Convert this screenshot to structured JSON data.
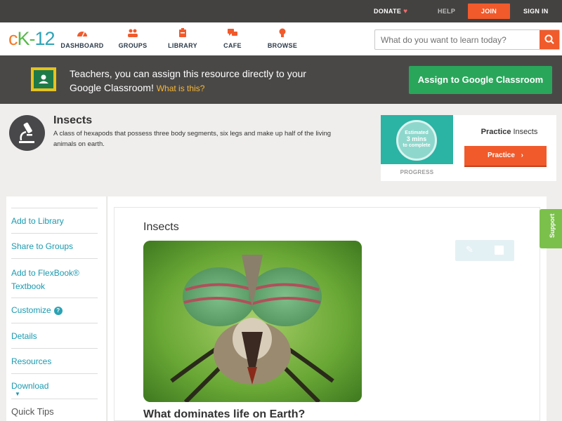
{
  "topbar": {
    "donate_label": "DONATE",
    "help_label": "HELP",
    "join_label": "JOIN",
    "signin_label": "SIGN IN"
  },
  "header": {
    "logo_c": "c",
    "logo_k": "K",
    "logo_dash": "-",
    "logo_num": "12",
    "nav": [
      {
        "label": "DASHBOARD",
        "icon": "dashboard-icon"
      },
      {
        "label": "GROUPS",
        "icon": "groups-icon"
      },
      {
        "label": "LIBRARY",
        "icon": "library-icon"
      },
      {
        "label": "CAFE",
        "icon": "cafe-icon"
      },
      {
        "label": "BROWSE",
        "icon": "browse-icon"
      }
    ],
    "search_placeholder": "What do you want to learn today?"
  },
  "banner": {
    "text": "Teachers, you can assign this resource directly to your Google Classroom!",
    "link": "What is this?",
    "button": "Assign to Google Classroom"
  },
  "concept": {
    "title": "Insects",
    "description": "A class of hexapods that possess three body segments, six legs and make up half of the living animals on earth.",
    "practice": {
      "circle_line1": "Estimated",
      "circle_mins": "3 mins",
      "circle_line3": "to complete",
      "progress_label": "PROGRESS",
      "title_bold": "Practice",
      "title_rest": "Insects",
      "button": "Practice"
    }
  },
  "sidebar": {
    "items": [
      {
        "label": "Add to Library"
      },
      {
        "label": "Share to Groups"
      },
      {
        "label": "Add to FlexBook® Textbook"
      },
      {
        "label": "Customize"
      },
      {
        "label": "Details"
      },
      {
        "label": "Resources"
      },
      {
        "label": "Download"
      },
      {
        "label": "Quick Tips"
      }
    ],
    "badge": "?"
  },
  "main": {
    "title": "Insects",
    "subheading": "What dominates life on Earth?"
  },
  "support": {
    "label": "Support"
  },
  "colors": {
    "accent": "#f15a2b",
    "teal": "#1a9ab0",
    "green": "#2aa65b",
    "banner_bg": "#4a4847"
  }
}
